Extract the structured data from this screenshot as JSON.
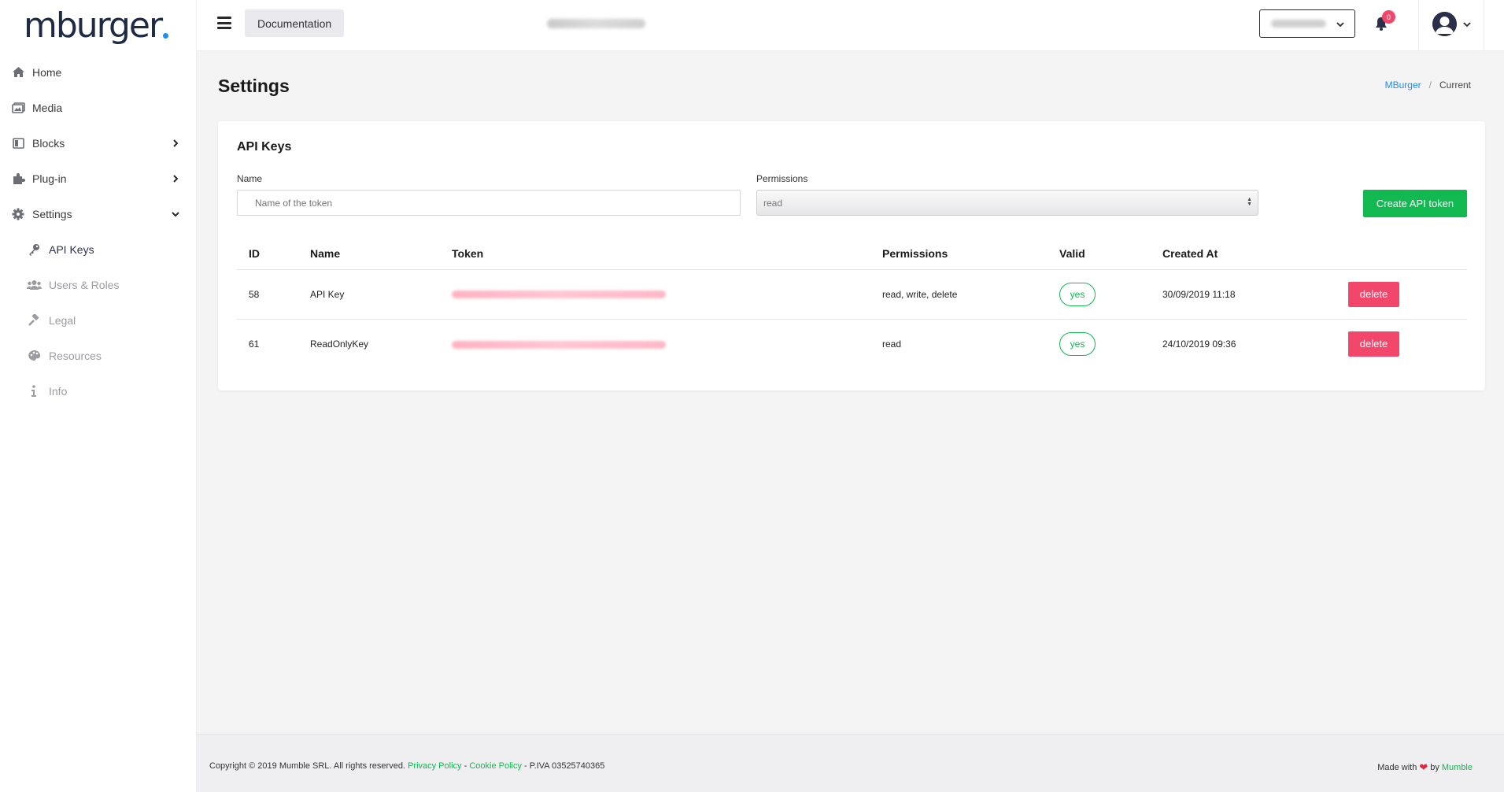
{
  "brand": {
    "name": "mburger",
    "accent": "#1b8ef2"
  },
  "sidebar": {
    "items": [
      {
        "label": "Home",
        "icon": "home-icon"
      },
      {
        "label": "Media",
        "icon": "images-icon"
      },
      {
        "label": "Blocks",
        "icon": "book-icon"
      },
      {
        "label": "Plug-in",
        "icon": "puzzle-icon"
      },
      {
        "label": "Settings",
        "icon": "gear-icon"
      }
    ],
    "settings_sub": [
      {
        "label": "API Keys",
        "icon": "key-icon",
        "active": true
      },
      {
        "label": "Users & Roles",
        "icon": "users-icon"
      },
      {
        "label": "Legal",
        "icon": "gavel-icon"
      },
      {
        "label": "Resources",
        "icon": "palette-icon"
      },
      {
        "label": "Info",
        "icon": "info-icon"
      }
    ]
  },
  "header": {
    "documentation_label": "Documentation",
    "notification_count": "0"
  },
  "page": {
    "title": "Settings",
    "breadcrumb": {
      "root": "MBurger",
      "sep": "/",
      "current": "Current"
    }
  },
  "api_keys": {
    "title": "API Keys",
    "name_label": "Name",
    "name_placeholder": "Name of the token",
    "permissions_label": "Permissions",
    "permissions_value": "read",
    "create_label": "Create API token",
    "columns": [
      "ID",
      "Name",
      "Token",
      "Permissions",
      "Valid",
      "Created At"
    ],
    "rows": [
      {
        "id": "58",
        "name": "API Key",
        "permissions": "read, write, delete",
        "valid": "yes",
        "created_at": "30/09/2019 11:18",
        "action": "delete"
      },
      {
        "id": "61",
        "name": "ReadOnlyKey",
        "permissions": "read",
        "valid": "yes",
        "created_at": "24/10/2019 09:36",
        "action": "delete"
      }
    ]
  },
  "footer": {
    "copyright": "Copyright © 2019 Mumble SRL. All rights reserved.",
    "privacy": "Privacy Policy",
    "dash1": "-",
    "cookie": "Cookie Policy",
    "piva": "- P.IVA 03525740365",
    "made_with": "Made with",
    "by": "by",
    "company": "Mumble"
  },
  "colors": {
    "green": "#12b850",
    "red": "#f2466a",
    "blue": "#1b8ef2"
  }
}
